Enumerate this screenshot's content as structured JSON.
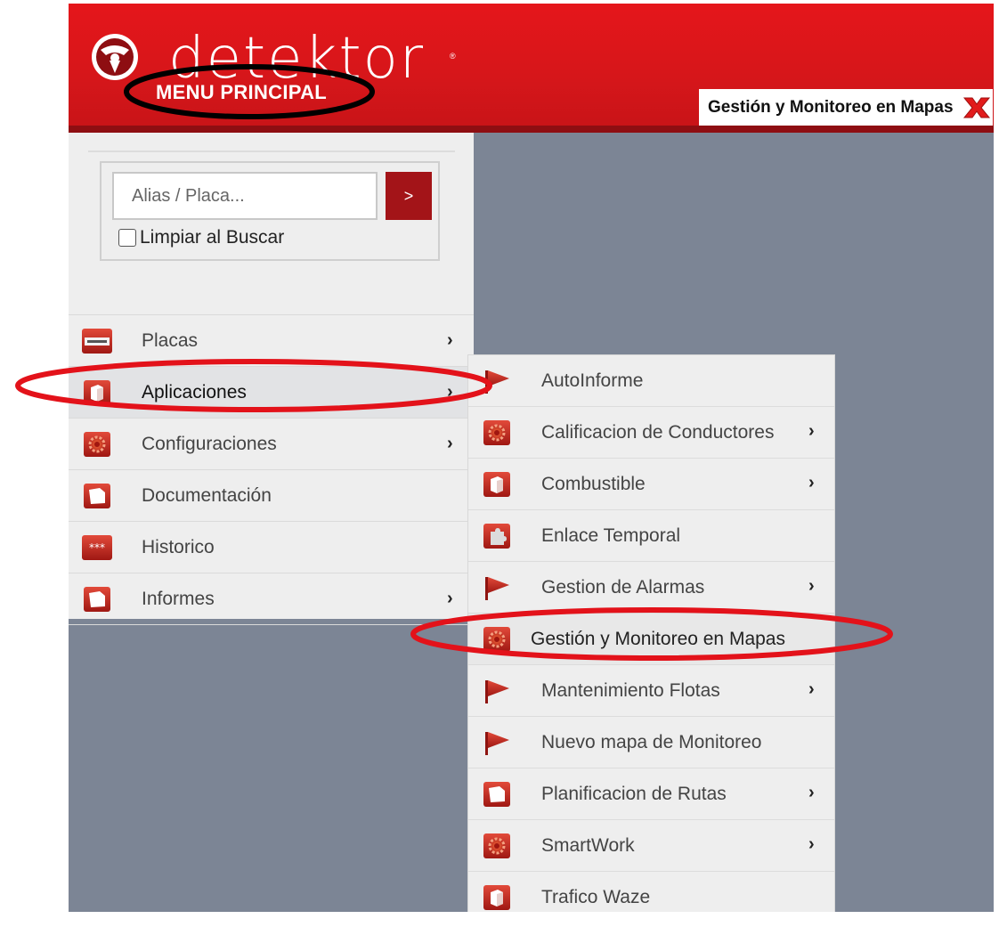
{
  "header": {
    "brand": "detektor",
    "brand_mark": "®",
    "subtitle": "MENU PRINCIPAL",
    "tab_label": "Gestión y Monitoreo en Mapas",
    "tab_close_icon": "close-x-icon"
  },
  "search": {
    "placeholder": "Alias / Placa...",
    "value": "",
    "button_label": ">",
    "clear_label": "Limpiar al Buscar",
    "clear_checked": false
  },
  "menu": {
    "items": [
      {
        "label": "Placas",
        "icon": "license-plate-icon",
        "arrow": "›"
      },
      {
        "label": "Aplicaciones",
        "icon": "box-icon",
        "arrow": "›"
      },
      {
        "label": "Configuraciones",
        "icon": "gear-icon",
        "arrow": "›"
      },
      {
        "label": "Documentación",
        "icon": "folder-icon",
        "arrow": ""
      },
      {
        "label": "Historico",
        "icon": "password-icon",
        "arrow": ""
      },
      {
        "label": "Informes",
        "icon": "folder-icon",
        "arrow": "›"
      }
    ]
  },
  "submenu": {
    "items": [
      {
        "label": "AutoInforme",
        "icon": "flag-icon",
        "arrow": ""
      },
      {
        "label": "Calificacion de Conductores",
        "icon": "gear-icon",
        "arrow": "›"
      },
      {
        "label": "Combustible",
        "icon": "box-icon",
        "arrow": "›"
      },
      {
        "label": "Enlace Temporal",
        "icon": "puzzle-icon",
        "arrow": ""
      },
      {
        "label": "Gestion de Alarmas",
        "icon": "flag-icon",
        "arrow": "›"
      },
      {
        "label": "Gestión y Monitoreo en Mapas",
        "icon": "gear-icon",
        "arrow": ""
      },
      {
        "label": "Mantenimiento Flotas",
        "icon": "flag-icon",
        "arrow": "›"
      },
      {
        "label": "Nuevo mapa de Monitoreo",
        "icon": "flag-icon",
        "arrow": ""
      },
      {
        "label": "Planificacion de Rutas",
        "icon": "folder-icon",
        "arrow": "›"
      },
      {
        "label": "SmartWork",
        "icon": "gear-icon",
        "arrow": "›"
      },
      {
        "label": "Trafico Waze",
        "icon": "box-icon",
        "arrow": ""
      }
    ]
  },
  "colors": {
    "header_red": "#d6161a",
    "header_bottom": "#8e0e12",
    "button_red": "#a31418",
    "workspace_gray": "#7c8595",
    "panel_bg": "#eeeeee",
    "annotation_black": "#000000",
    "annotation_red": "#e3121a"
  }
}
